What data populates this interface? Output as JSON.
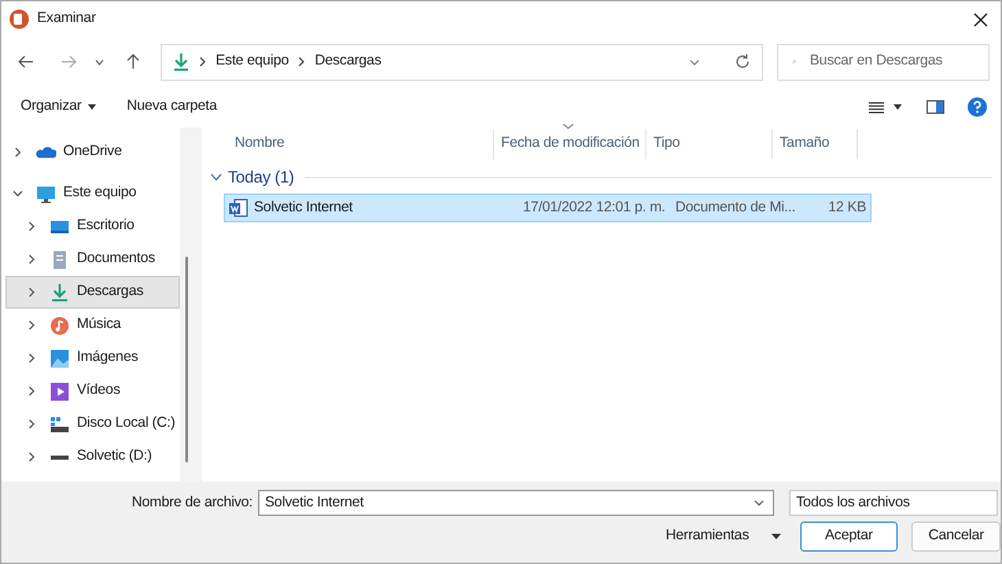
{
  "window": {
    "title": "Examinar"
  },
  "address": {
    "path": [
      "Este equipo",
      "Descargas"
    ]
  },
  "search": {
    "placeholder": "Buscar en Descargas"
  },
  "toolbar": {
    "organize": "Organizar",
    "new_folder": "Nueva carpeta"
  },
  "sidebar": {
    "items": [
      {
        "label": "OneDrive",
        "kind": "cloud",
        "expanded": false,
        "selected": false
      },
      {
        "label": "Este equipo",
        "kind": "pc",
        "expanded": true,
        "selected": false,
        "children": [
          {
            "label": "Escritorio",
            "kind": "desktop",
            "expanded": false,
            "selected": false
          },
          {
            "label": "Documentos",
            "kind": "documents",
            "expanded": false,
            "selected": false
          },
          {
            "label": "Descargas",
            "kind": "downloads",
            "expanded": false,
            "selected": true
          },
          {
            "label": "Música",
            "kind": "music",
            "expanded": false,
            "selected": false
          },
          {
            "label": "Imágenes",
            "kind": "pictures",
            "expanded": false,
            "selected": false
          },
          {
            "label": "Vídeos",
            "kind": "videos",
            "expanded": false,
            "selected": false
          },
          {
            "label": "Disco Local (C:)",
            "kind": "disk",
            "expanded": false,
            "selected": false
          },
          {
            "label": "Solvetic (D:)",
            "kind": "drive",
            "expanded": false,
            "selected": false
          }
        ]
      }
    ]
  },
  "table": {
    "columns": [
      {
        "label": "Nombre",
        "sorted": false
      },
      {
        "label": "Fecha de modificación",
        "sorted": true
      },
      {
        "label": "Tipo",
        "sorted": false
      },
      {
        "label": "Tamaño",
        "sorted": false
      }
    ],
    "groups": [
      {
        "label": "Today (1)",
        "expanded": true,
        "rows": [
          {
            "name": "Solvetic Internet",
            "date": "17/01/2022 12:01 p. m.",
            "type": "Documento de Mi...",
            "size": "12 KB",
            "selected": true
          }
        ]
      }
    ]
  },
  "footer": {
    "filename_label": "Nombre de archivo:",
    "filename": "Solvetic Internet",
    "filter": "Todos los archivos",
    "tools": "Herramientas",
    "accept": "Aceptar",
    "cancel": "Cancelar"
  }
}
